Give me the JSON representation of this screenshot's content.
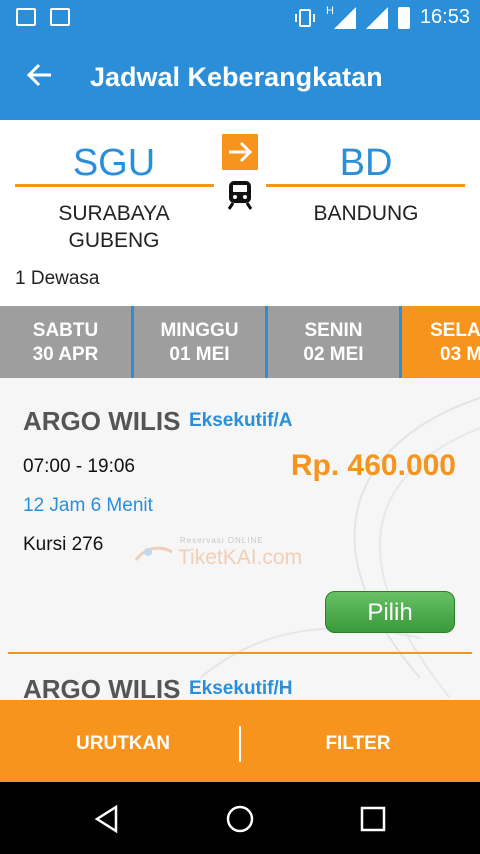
{
  "status_bar": {
    "time": "16:53",
    "network": "H"
  },
  "header": {
    "back_icon": "arrow-left-icon",
    "title": "Jadwal Keberangkatan"
  },
  "route": {
    "origin": {
      "code": "SGU",
      "name": "SURABAYA\nGUBENG"
    },
    "destination": {
      "code": "BD",
      "name": "BANDUNG"
    },
    "passengers": "1 Dewasa"
  },
  "dates": [
    {
      "day": "SABTU",
      "date": "30 APR"
    },
    {
      "day": "MINGGU",
      "date": "01 MEI"
    },
    {
      "day": "SENIN",
      "date": "02 MEI"
    },
    {
      "day": "SELA",
      "date": "03 M"
    }
  ],
  "trains": [
    {
      "name": "ARGO WILIS",
      "class": "Eksekutif/A",
      "time": "07:00 - 19:06",
      "price": "Rp. 460.000",
      "duration": "12 Jam 6 Menit",
      "seats": "Kursi 276",
      "select_label": "Pilih"
    },
    {
      "name": "ARGO WILIS",
      "class": "Eksekutif/H"
    }
  ],
  "watermark": {
    "line1": "Reservasi ONLINE",
    "line2": "TiketKAI.com"
  },
  "bottom_bar": {
    "sort_label": "URUTKAN",
    "filter_label": "FILTER"
  },
  "colors": {
    "primary": "#2a8fd8",
    "accent": "#f7941d",
    "button_green": "#4caf50"
  }
}
